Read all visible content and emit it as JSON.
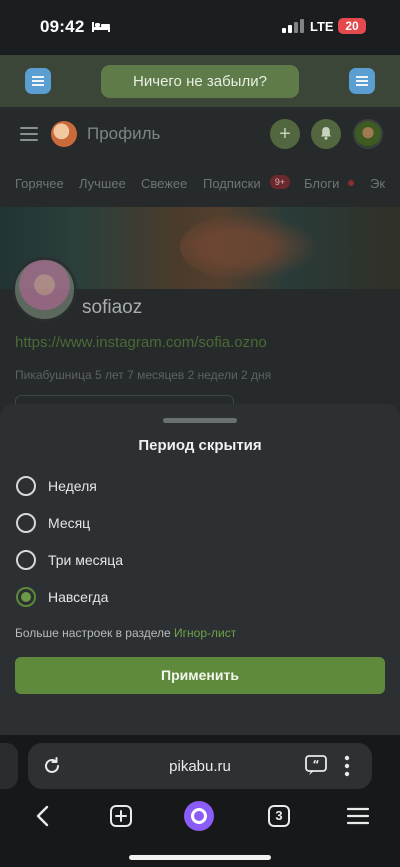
{
  "status_bar": {
    "time": "09:42",
    "network": "LTE",
    "battery": "20"
  },
  "banner": {
    "button_label": "Ничего не забыли?"
  },
  "appbar": {
    "title": "Профиль"
  },
  "tabs": [
    {
      "label": "Горячее"
    },
    {
      "label": "Лучшее"
    },
    {
      "label": "Свежее"
    },
    {
      "label": "Подписки"
    },
    {
      "label": "Блоги"
    },
    {
      "label": "Эк"
    }
  ],
  "tab_badge": "9+",
  "profile": {
    "username": "sofiaoz",
    "link": "https://www.instagram.com/sofia.ozno",
    "meta": "Пикабушница 5 лет 7 месяцев 2 недели 2 дня"
  },
  "sheet": {
    "title": "Период скрытия",
    "options": [
      {
        "label": "Неделя",
        "selected": false
      },
      {
        "label": "Месяц",
        "selected": false
      },
      {
        "label": "Три месяца",
        "selected": false
      },
      {
        "label": "Навсегда",
        "selected": true
      }
    ],
    "more_prefix": "Больше настроек в разделе ",
    "more_link": "Игнор-лист",
    "apply_label": "Применить"
  },
  "browser": {
    "url": "pikabu.ru",
    "tab_count": "3"
  },
  "colors": {
    "accent": "#5f8a3d",
    "link": "#6da249",
    "badge": "#e5484d"
  }
}
